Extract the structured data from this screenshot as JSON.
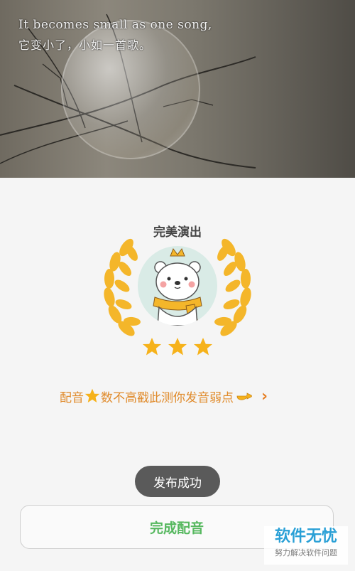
{
  "video": {
    "subtitle_en": "It becomes small as one song,",
    "subtitle_cn": "它变小了，小如一首歌。"
  },
  "result": {
    "title": "完美演出",
    "stars_earned": 3,
    "stars_total": 3
  },
  "hint": {
    "text_before": "配音",
    "text_after": "数不高戳此测你发音弱点",
    "chevron": "›"
  },
  "toast": {
    "label": "发布成功"
  },
  "done_button": {
    "label": "完成配音"
  },
  "watermark": {
    "line1": "软件无忧",
    "line2": "努力解决软件问题"
  },
  "colors": {
    "accent_orange": "#e08a2a",
    "star_gold": "#f6b21a",
    "done_green": "#56b85f",
    "toast_bg": "#5a5a5a"
  },
  "icons": [
    "laurel-wreath-icon",
    "bear-king-avatar",
    "star-icon",
    "pointing-hand-icon",
    "chevron-right-icon"
  ]
}
